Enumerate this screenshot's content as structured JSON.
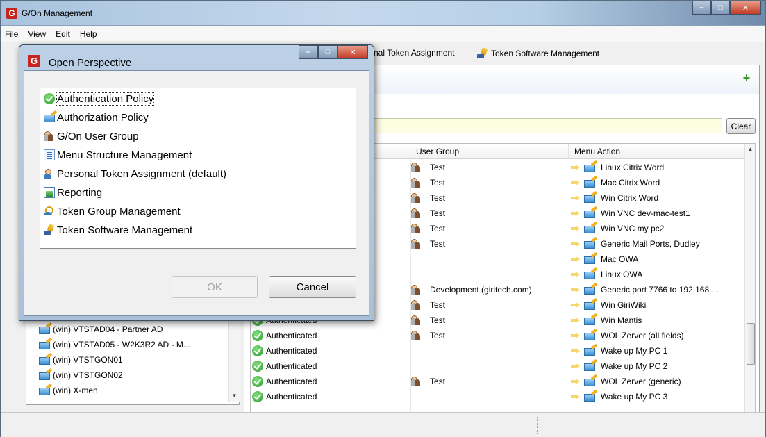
{
  "window": {
    "title": "G/On Management",
    "app_icon_letter": "G"
  },
  "menu": {
    "items": [
      "File",
      "View",
      "Edit",
      "Help"
    ]
  },
  "toolbar": {
    "partial_item": "nal Token Assignment",
    "token_software": "Token Software Management"
  },
  "right_panel": {
    "header_fragment": "y",
    "clear_label": "Clear",
    "columns": [
      "User Group",
      "Menu Action"
    ],
    "rows": [
      {
        "auth": "",
        "group": "Test",
        "menu": "Linux Citrix Word"
      },
      {
        "auth": "",
        "group": "Test",
        "menu": "Mac Citrix Word"
      },
      {
        "auth": "",
        "group": "Test",
        "menu": "Win Citrix Word"
      },
      {
        "auth": "",
        "group": "Test",
        "menu": "Win VNC dev-mac-test1"
      },
      {
        "auth": "",
        "group": "Test",
        "menu": "Win VNC my pc2"
      },
      {
        "auth": "",
        "group": "Test",
        "menu": "Generic Mail Ports, Dudley"
      },
      {
        "auth": "",
        "group": "",
        "menu": "Mac OWA"
      },
      {
        "auth": "",
        "group": "",
        "menu": "Linux OWA"
      },
      {
        "auth": "",
        "group": "Development (giritech.com)",
        "menu": "Generic port 7766 to 192.168...."
      },
      {
        "auth": "",
        "group": "Test",
        "menu": "Win GiriWiki"
      },
      {
        "auth": "Authenticated",
        "group": "Test",
        "menu": "Win Mantis"
      },
      {
        "auth": "Authenticated",
        "group": "Test",
        "menu": "WOL Zerver (all fields)"
      },
      {
        "auth": "Authenticated",
        "group": "",
        "menu": "Wake up My PC 1"
      },
      {
        "auth": "Authenticated",
        "group": "",
        "menu": "Wake up My PC 2"
      },
      {
        "auth": "Authenticated",
        "group": "Test",
        "menu": "WOL Zerver (generic)"
      },
      {
        "auth": "Authenticated",
        "group": "",
        "menu": "Wake up My PC 3"
      }
    ]
  },
  "left_panel": {
    "items": [
      "(win) VTSTAD04 - Partner AD",
      "(win) VTSTAD05 - W2K3R2 AD - M...",
      "(win) VTSTGON01",
      "(win) VTSTGON02",
      "(win) X-men"
    ]
  },
  "dialog": {
    "title": "Open Perspective",
    "items": [
      {
        "label": "Authentication Policy",
        "icon": "check-icon",
        "selected": true
      },
      {
        "label": "Authorization Policy",
        "icon": "authorization-icon"
      },
      {
        "label": "G/On User Group",
        "icon": "user-group-icon"
      },
      {
        "label": "Menu Structure Management",
        "icon": "list-icon"
      },
      {
        "label": "Personal Token Assignment (default)",
        "icon": "person-icon"
      },
      {
        "label": "Reporting",
        "icon": "report-icon"
      },
      {
        "label": "Token Group Management",
        "icon": "token-group-icon"
      },
      {
        "label": "Token Software Management",
        "icon": "token-software-icon"
      }
    ],
    "ok_label": "OK",
    "cancel_label": "Cancel"
  }
}
